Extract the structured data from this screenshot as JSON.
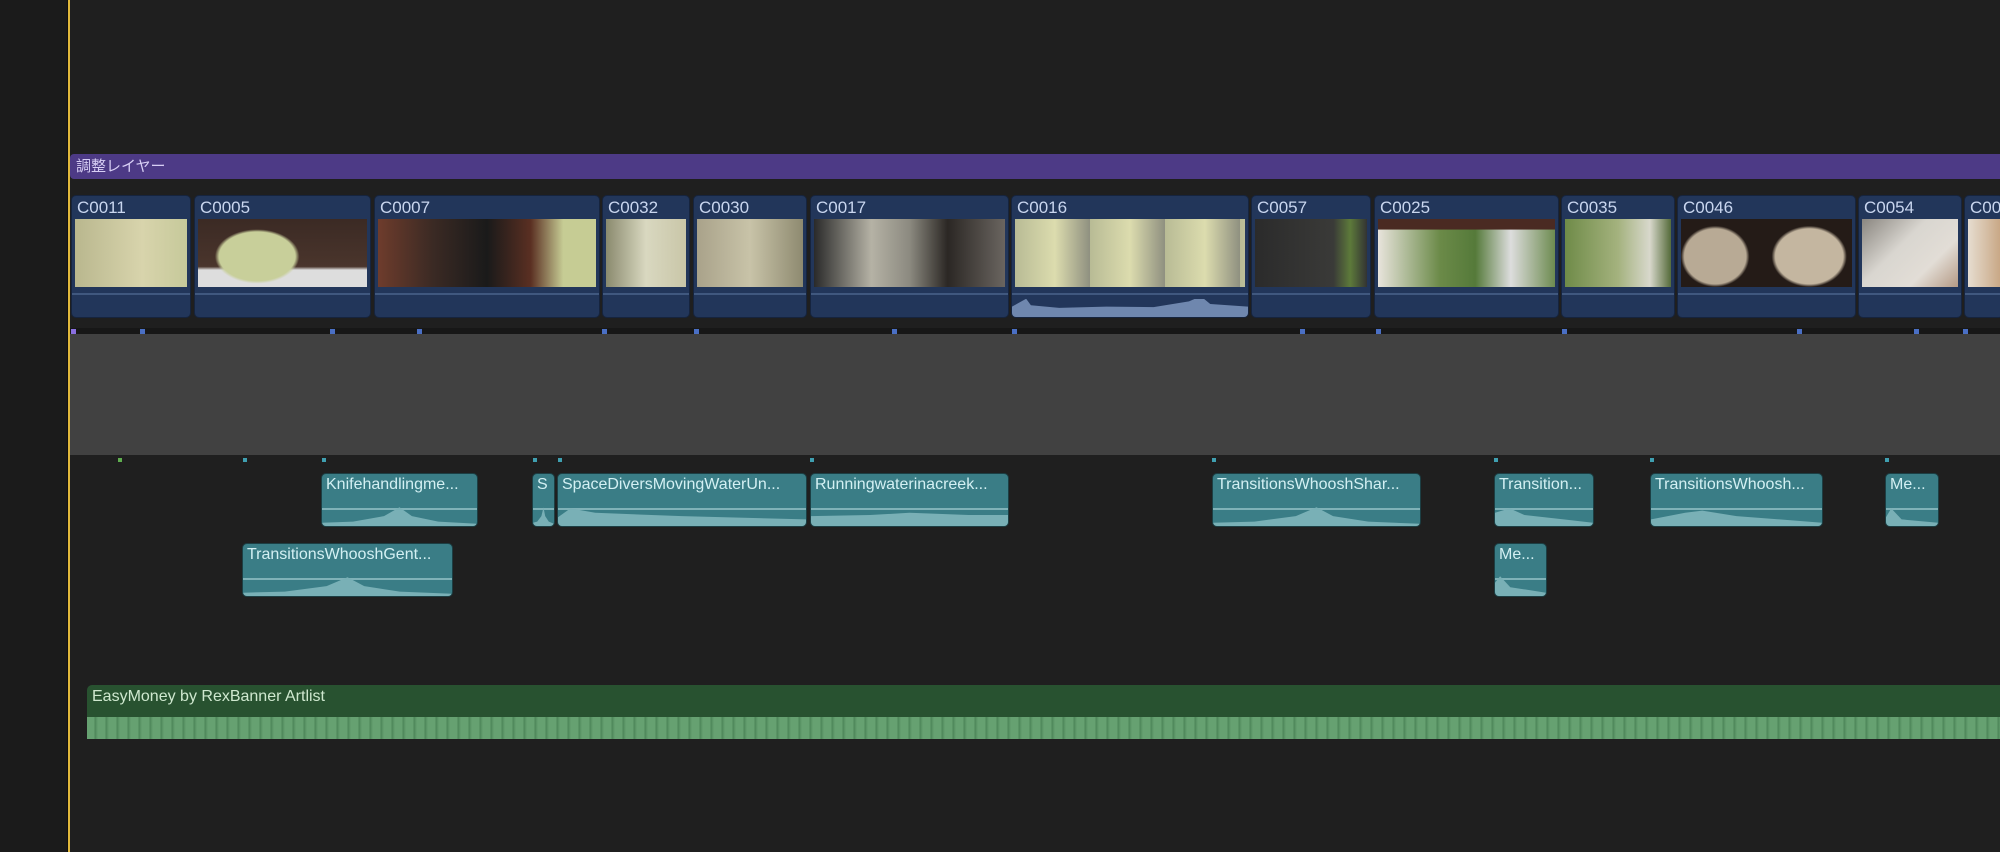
{
  "adjustment_layer": {
    "label": "調整レイヤー"
  },
  "video_clips": [
    "C0011",
    "C0005",
    "C0007",
    "C0032",
    "C0030",
    "C0017",
    "C0016",
    "C0057",
    "C0025",
    "C0035",
    "C0046",
    "C0054",
    "C00"
  ],
  "audio_clips_row1": [
    "Knifehandlingme...",
    "S",
    "SpaceDiversMovingWaterUn...",
    "Runningwaterinacreek...",
    "TransitionsWhooshShar...",
    "Transition...",
    "TransitionsWhoosh...",
    "Me..."
  ],
  "audio_clips_row2": [
    "TransitionsWhooshGent...",
    "Me..."
  ],
  "music": {
    "label": "EasyMoney by RexBanner Artlist"
  }
}
